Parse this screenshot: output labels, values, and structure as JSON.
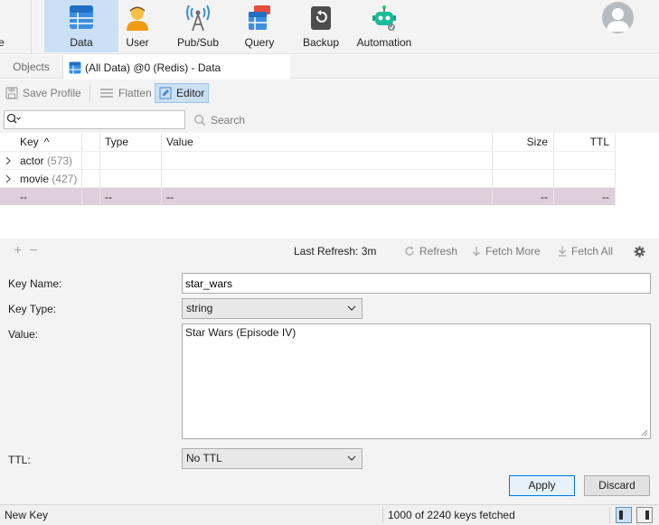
{
  "toolbar": {
    "edge_label": "e",
    "buttons": [
      {
        "label": "Data",
        "icon": "data-grid-icon"
      },
      {
        "label": "User",
        "icon": "user-icon"
      },
      {
        "label": "Pub/Sub",
        "icon": "broadcast-tower-icon"
      },
      {
        "label": "Query",
        "icon": "query-icon"
      },
      {
        "label": "Backup",
        "icon": "backup-icon"
      },
      {
        "label": "Automation",
        "icon": "robot-icon"
      }
    ],
    "active": "Data"
  },
  "tabs": {
    "objects": "Objects",
    "data": "(All Data) @0 (Redis) - Data"
  },
  "editor_toolbar": {
    "save_profile": "Save Profile",
    "flatten": "Flatten",
    "editor": "Editor"
  },
  "search": {
    "value": "",
    "button": "Search"
  },
  "table": {
    "headers": {
      "key": "Key",
      "type": "Type",
      "value": "Value",
      "size": "Size",
      "ttl": "TTL"
    },
    "rows": [
      {
        "key": "actor",
        "count": "(573)"
      },
      {
        "key": "movie",
        "count": "(427)"
      }
    ],
    "new_row": {
      "key": "--",
      "type": "--",
      "value": "--",
      "size": "--",
      "ttl": "--"
    }
  },
  "table_footer": {
    "last_refresh": "Last Refresh: 3m",
    "refresh": "Refresh",
    "fetch_more": "Fetch More",
    "fetch_all": "Fetch All"
  },
  "form": {
    "key_name_label": "Key Name:",
    "key_name_value": "star_wars",
    "key_type_label": "Key Type:",
    "key_type_value": "string",
    "value_label": "Value:",
    "value_value": "Star Wars (Episode IV)",
    "ttl_label": "TTL:",
    "ttl_value": "No TTL",
    "apply": "Apply",
    "discard": "Discard"
  },
  "status": {
    "left": "New Key",
    "fetched": "1000 of 2240 keys fetched"
  },
  "colors": {
    "accent_selected": "#cce0f5",
    "selected_row": "#decfdd",
    "primary_border": "#0078d7"
  }
}
